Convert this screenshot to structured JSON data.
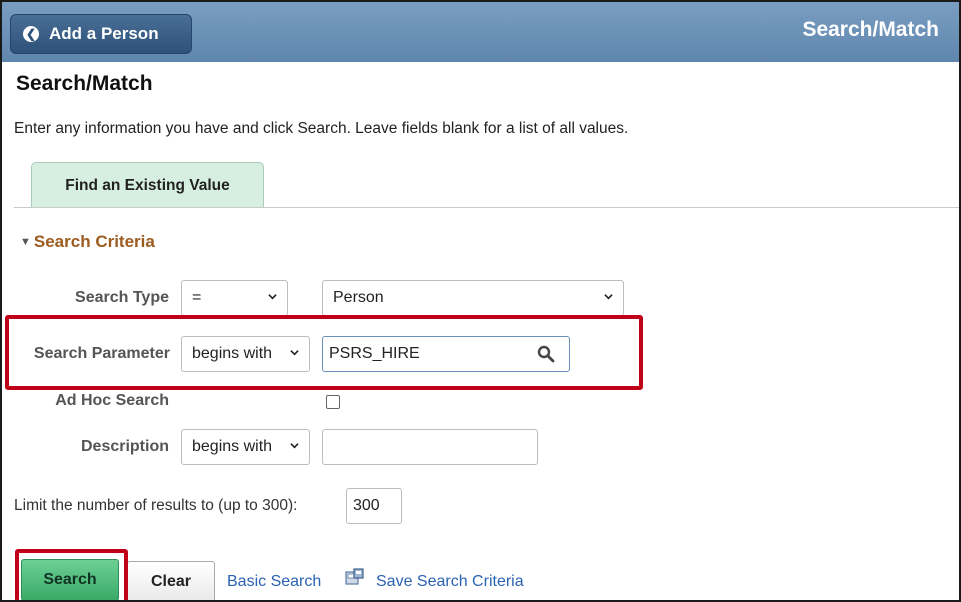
{
  "header": {
    "back_label": "Add a Person",
    "title": "Search/Match"
  },
  "page": {
    "title": "Search/Match",
    "instructions": "Enter any information you have and click Search. Leave fields blank for a list of all values."
  },
  "tabs": [
    {
      "label": "Find an Existing Value",
      "active": true
    }
  ],
  "search_criteria": {
    "heading": "Search Criteria",
    "expanded": true,
    "search_type": {
      "label": "Search Type",
      "operator": "=",
      "value": "Person"
    },
    "search_parameter": {
      "label": "Search Parameter",
      "operator": "begins with",
      "value": "PSRS_HIRE"
    },
    "ad_hoc_search": {
      "label": "Ad Hoc Search",
      "checked": false
    },
    "description": {
      "label": "Description",
      "operator": "begins with",
      "value": ""
    }
  },
  "limit": {
    "label": "Limit the number of results to (up to 300):",
    "value": "300"
  },
  "actions": {
    "search_label": "Search",
    "clear_label": "Clear",
    "basic_search_label": "Basic Search",
    "save_criteria_label": "Save Search Criteria"
  },
  "icons": {
    "back": "chevron-left-icon",
    "dropdown": "chevron-down-icon",
    "lookup": "search-icon",
    "save": "save-criteria-icon",
    "section_toggle": "triangle-down-icon"
  },
  "colors": {
    "header_bg": "#6f93b8",
    "back_button_bg": "#2d5178",
    "tab_bg": "#d7efe1",
    "section_heading": "#9c5b1f",
    "search_button": "#3aaa68",
    "link": "#2a62b4",
    "annotation_highlight": "#c00018"
  }
}
